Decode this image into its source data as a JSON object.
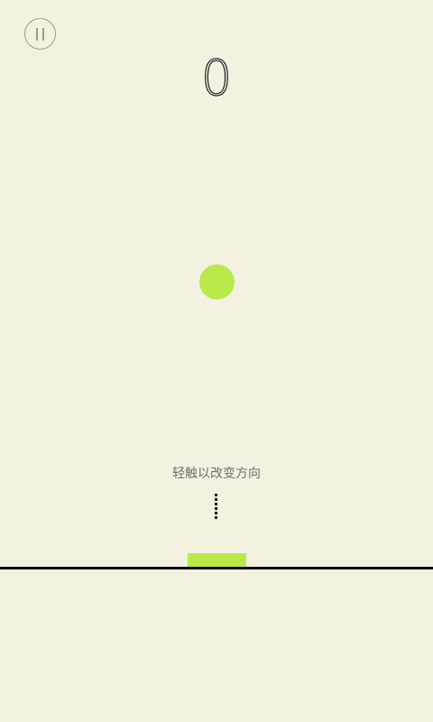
{
  "hud": {
    "pause_icon": "pause-icon",
    "score": "0"
  },
  "hint": {
    "text": "轻触以改变方向"
  },
  "colors": {
    "background": "#f4f1e1",
    "ball": "#b8e84a",
    "paddle": "#b8e84a",
    "ground": "#0d0d0d",
    "hint_text": "#6f6f6b"
  }
}
